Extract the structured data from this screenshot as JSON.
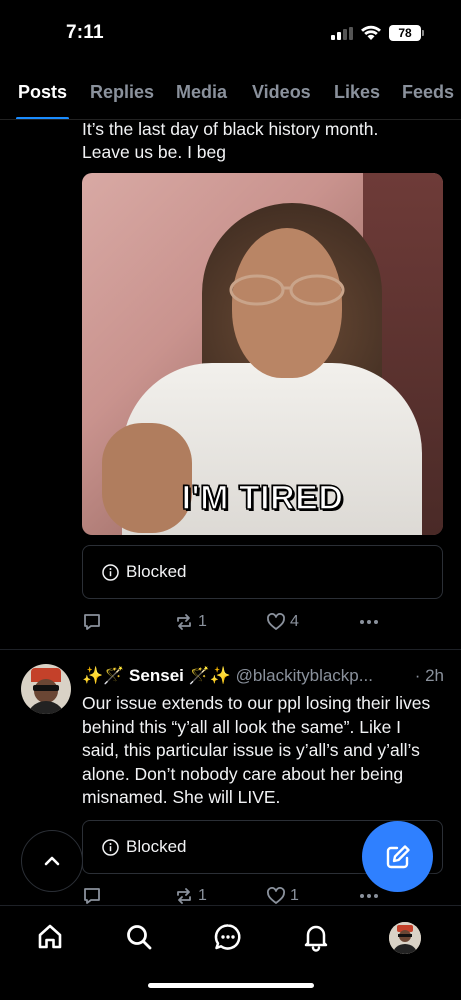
{
  "status_bar": {
    "time": "7:11",
    "battery": "78"
  },
  "tabs": [
    {
      "label": "Posts",
      "active": true
    },
    {
      "label": "Replies",
      "active": false
    },
    {
      "label": "Media",
      "active": false
    },
    {
      "label": "Videos",
      "active": false
    },
    {
      "label": "Likes",
      "active": false
    },
    {
      "label": "Feeds",
      "active": false
    }
  ],
  "post1": {
    "text_line1": "It’s the last day of black history month.",
    "text_line2": "Leave us be. I beg",
    "gif_caption": "I'M TIRED",
    "blocked_label": "Blocked",
    "reply_icon": "reply-icon",
    "repost_count": "1",
    "like_count": "4"
  },
  "post2": {
    "display_name": "✨🪄 Sensei 🪄✨",
    "handle": "@blackityblackp...",
    "time": "· 2h",
    "text": "Our issue extends to our ppl losing their lives behind this “y’all all look the same”. Like I said, this particular issue is y’all’s and y’all’s alone. Don’t nobody care about her being misnamed. She will LIVE.",
    "blocked_label": "Blocked",
    "repost_count": "1",
    "like_count": "1"
  },
  "icons": {
    "scroll_top": "chevron-up-icon",
    "compose": "compose-icon",
    "nav": [
      "home-icon",
      "search-icon",
      "chat-icon",
      "bell-icon",
      "profile-avatar"
    ]
  },
  "colors": {
    "accent": "#1a8cff",
    "compose_button": "#2f80ff",
    "muted": "#8a919c"
  }
}
